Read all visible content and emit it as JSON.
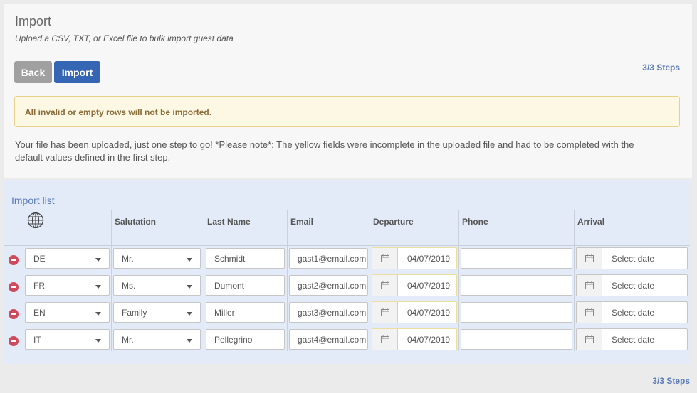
{
  "header": {
    "title": "Import",
    "subtitle": "Upload a CSV, TXT, or Excel file to bulk import guest data",
    "back_label": "Back",
    "import_label": "Import",
    "steps": "3/3 Steps"
  },
  "alert": "All invalid or empty rows will not be imported.",
  "note": "Your file has been uploaded, just one step to go! *Please note*: The yellow fields were incomplete in the uploaded file and had to be completed with the default values defined in the first step.",
  "import_list": {
    "title": "Import list",
    "columns": [
      "",
      "Salutation",
      "Last Name",
      "Email",
      "Departure",
      "Phone",
      "Arrival"
    ],
    "rows": [
      {
        "language": "DE",
        "salutation": "Mr.",
        "last_name": "Schmidt",
        "email": "gast1@email.com",
        "departure": "04/07/2019",
        "phone": "",
        "arrival": "Select date"
      },
      {
        "language": "FR",
        "salutation": "Ms.",
        "last_name": "Dumont",
        "email": "gast2@email.com",
        "departure": "04/07/2019",
        "phone": "",
        "arrival": "Select date"
      },
      {
        "language": "EN",
        "salutation": "Family",
        "last_name": "Miller",
        "email": "gast3@email.com",
        "departure": "04/07/2019",
        "phone": "",
        "arrival": "Select date"
      },
      {
        "language": "IT",
        "salutation": "Mr.",
        "last_name": "Pellegrino",
        "email": "gast4@email.com",
        "departure": "04/07/2019",
        "phone": "",
        "arrival": "Select date"
      }
    ]
  },
  "footer_steps": "3/3 Steps",
  "colors": {
    "primary": "#3466b4",
    "back": "#a0a0a0",
    "alert_bg": "#fcf8e3",
    "remove": "#d04a5e",
    "list_bg": "#e3ebf8"
  }
}
